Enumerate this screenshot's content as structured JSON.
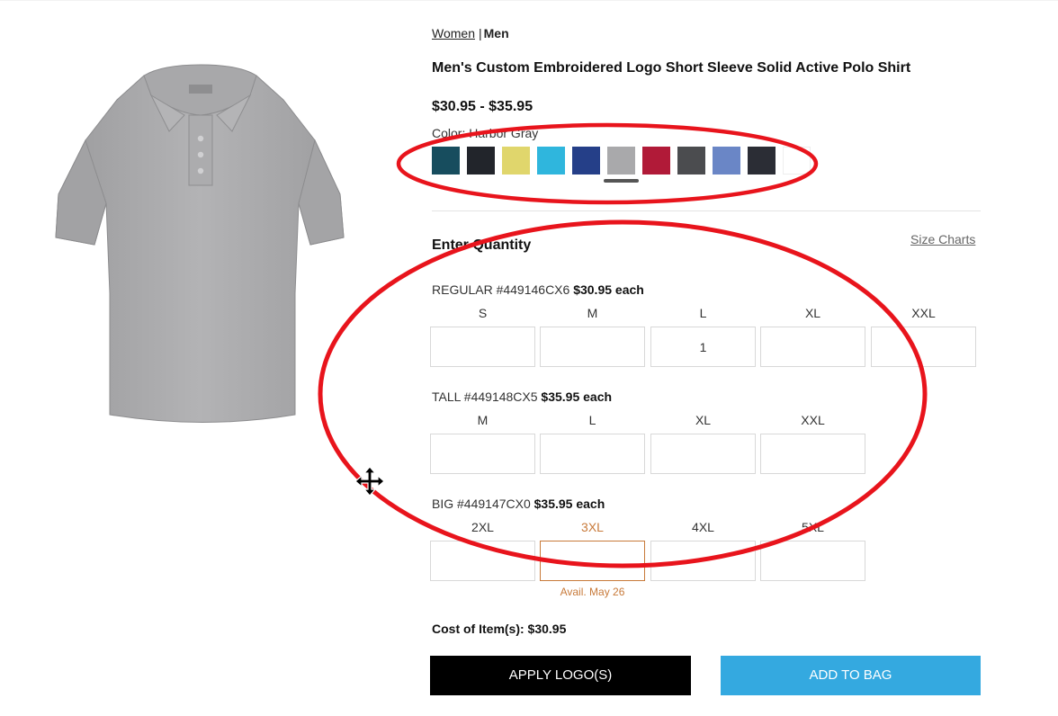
{
  "nav": {
    "women": "Women",
    "men": "Men"
  },
  "product": {
    "title": "Men's Custom Embroidered Logo Short Sleeve Solid Active Polo Shirt",
    "price_range": "$30.95 - $35.95",
    "color_label": "Color:",
    "color_value": "Harbor Gray",
    "image_icon": "polo-shirt-image"
  },
  "swatches": [
    {
      "color": "#174d5e"
    },
    {
      "color": "#22252b"
    },
    {
      "color": "#e0d66c"
    },
    {
      "color": "#2fb6dd"
    },
    {
      "color": "#253f88"
    },
    {
      "color": "#a9a9ab",
      "selected": true
    },
    {
      "color": "#b11a38"
    },
    {
      "color": "#4b4c4f"
    },
    {
      "color": "#6a86c6"
    },
    {
      "color": "#2b2d35"
    },
    {
      "color": "#ffffff"
    }
  ],
  "quantity": {
    "heading": "Enter Quantity",
    "size_charts": "Size Charts",
    "groups": [
      {
        "label": "REGULAR #449146CX6",
        "price": "$30.95 each",
        "sizes": [
          "S",
          "M",
          "L",
          "XL",
          "XXL"
        ],
        "values": [
          "",
          "",
          "1",
          "",
          ""
        ]
      },
      {
        "label": "TALL #449148CX5",
        "price": "$35.95 each",
        "sizes": [
          "M",
          "L",
          "XL",
          "XXL"
        ],
        "values": [
          "",
          "",
          "",
          ""
        ]
      },
      {
        "label": "BIG #449147CX0",
        "price": "$35.95 each",
        "sizes": [
          "2XL",
          "3XL",
          "4XL",
          "5XL"
        ],
        "values": [
          "",
          "",
          "",
          ""
        ],
        "availability_note": "Avail. May 26"
      }
    ]
  },
  "summary": {
    "cost": "Cost of Item(s): $30.95"
  },
  "buttons": {
    "apply_logo": "APPLY LOGO(S)",
    "add_to_bag": "ADD TO BAG"
  },
  "colors": {
    "accent_blue": "#34a9e0",
    "annotation_red": "#e8141c",
    "warning": "#c87a3a"
  }
}
